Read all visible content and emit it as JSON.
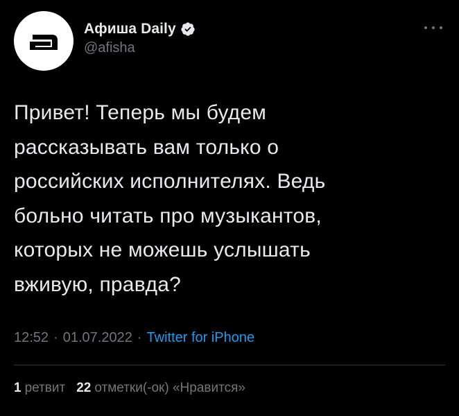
{
  "author": {
    "display_name": "Афиша Daily",
    "handle": "@afisha",
    "verified": true,
    "avatar_icon": "afisha-logo-icon"
  },
  "tweet": {
    "text": "Привет! Теперь мы будем\nрассказывать вам только о\nроссийских исполнителях. Ведь\nбольно читать про музыкантов,\nкоторых не можешь услышать\nвживую, правда?",
    "time": "12:52",
    "separator": "·",
    "date": "01.07.2022",
    "source": "Twitter for iPhone"
  },
  "stats": {
    "retweets_count": "1",
    "retweets_label": "ретвит",
    "likes_count": "22",
    "likes_label": "отметки(-ок) «Нравится»"
  },
  "colors": {
    "background": "#000000",
    "text": "#e7e9ea",
    "secondary": "#71767b",
    "accent": "#1d9bf0",
    "divider": "#2f3336"
  }
}
